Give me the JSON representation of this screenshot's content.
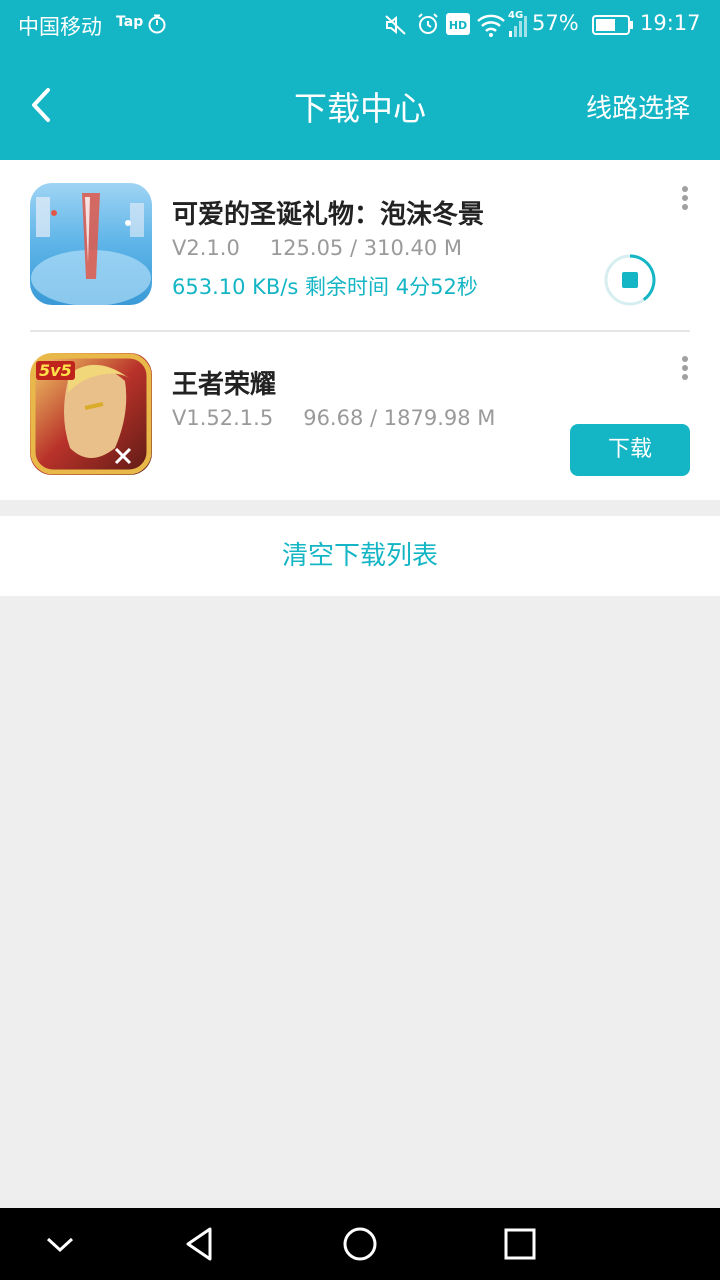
{
  "status_bar": {
    "carrier": "中国移动",
    "tap_label": "Tap",
    "network": "4G",
    "battery": "57%",
    "time": "19:17",
    "icons": [
      "timer-icon",
      "mute-icon",
      "alarm-icon",
      "hd-icon",
      "wifi-icon",
      "signal-icon",
      "battery-icon"
    ]
  },
  "header": {
    "title": "下载中心",
    "route_select": "线路选择",
    "back_icon": "chevron-left-icon"
  },
  "downloads": [
    {
      "name": "可爱的圣诞礼物：泡沫冬景",
      "version": "V2.1.0",
      "progress": "125.05 / 310.40 M",
      "speed": "653.10 KB/s",
      "remaining_label": "剩余时间",
      "remaining": "4分52秒",
      "progress_fraction": 0.403,
      "action": "pause-icon"
    },
    {
      "name": "王者荣耀",
      "version": "V1.52.1.5",
      "progress": "96.68 / 1879.98 M",
      "button_label": "下载",
      "badge": "5v5"
    }
  ],
  "clear_list": "清空下载列表",
  "nav": [
    "chevron-down-icon",
    "back-triangle-icon",
    "home-circle-icon",
    "recents-square-icon"
  ],
  "colors": {
    "accent": "#14b5c5",
    "background": "#eeeeee",
    "title_text": "#222222",
    "meta_text": "#9a9a9a"
  }
}
